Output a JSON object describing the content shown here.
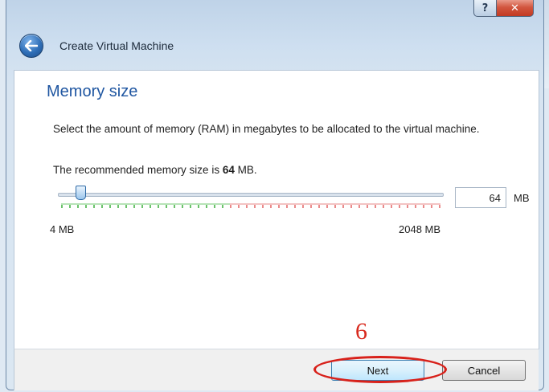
{
  "window": {
    "title": "Create Virtual Machine",
    "help_label": "?",
    "close_label": "✕"
  },
  "page": {
    "heading": "Memory size",
    "description": "Select the amount of memory (RAM) in megabytes to be allocated to the virtual machine.",
    "recommended_prefix": "The recommended memory size is",
    "recommended_value": "64",
    "recommended_suffix": "MB."
  },
  "memory": {
    "value": "64",
    "unit": "MB",
    "min_label": "4 MB",
    "max_label": "2048 MB",
    "slider_fraction": 0.03
  },
  "footer": {
    "next_label": "Next",
    "cancel_label": "Cancel",
    "annotation": "6"
  },
  "colors": {
    "heading": "#1f56a1",
    "annotation_red": "#d82a1e"
  }
}
